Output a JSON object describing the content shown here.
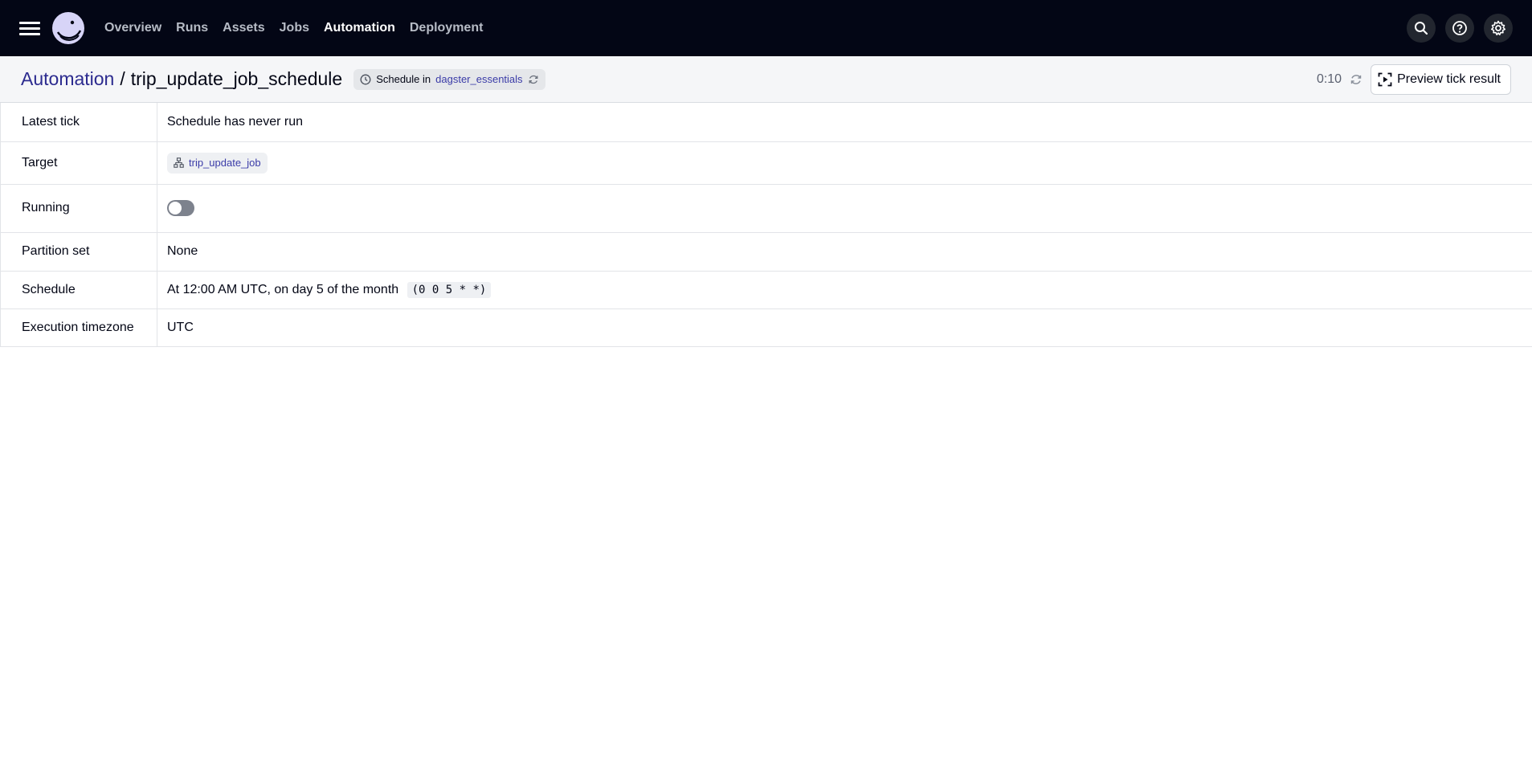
{
  "nav": {
    "links": [
      {
        "label": "Overview",
        "active": false
      },
      {
        "label": "Runs",
        "active": false
      },
      {
        "label": "Assets",
        "active": false
      },
      {
        "label": "Jobs",
        "active": false
      },
      {
        "label": "Automation",
        "active": true
      },
      {
        "label": "Deployment",
        "active": false
      }
    ],
    "icons": [
      "search-icon",
      "help-icon",
      "settings-icon"
    ]
  },
  "header": {
    "breadcrumb_link": "Automation",
    "separator": "/",
    "title": "trip_update_job_schedule",
    "tag_prefix": "Schedule in",
    "tag_repo": "dagster_essentials",
    "countdown": "0:10",
    "preview_button": "Preview tick result"
  },
  "details": {
    "latest_tick_label": "Latest tick",
    "latest_tick_value": "Schedule has never run",
    "target_label": "Target",
    "target_value": "trip_update_job",
    "running_label": "Running",
    "running_on": false,
    "partition_label": "Partition set",
    "partition_value": "None",
    "schedule_label": "Schedule",
    "schedule_value": "At 12:00 AM UTC, on day 5 of the month",
    "schedule_cron": "(0 0 5 * *)",
    "timezone_label": "Execution timezone",
    "timezone_value": "UTC"
  },
  "colors": {
    "nav_bg": "#030615",
    "link_accent": "#2c2b8f",
    "header_bg": "#f5f6f8"
  }
}
